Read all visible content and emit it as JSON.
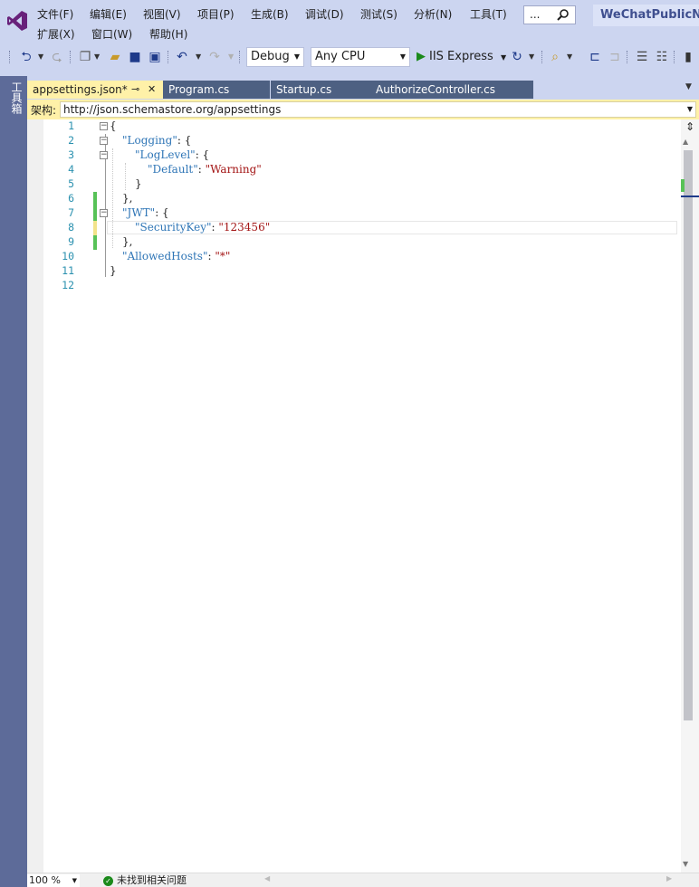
{
  "menu": {
    "row1": [
      "文件(F)",
      "编辑(E)",
      "视图(V)",
      "项目(P)",
      "生成(B)",
      "调试(D)",
      "测试(S)",
      "分析(N)",
      "工具(T)"
    ],
    "row2": [
      "扩展(X)",
      "窗口(W)",
      "帮助(H)"
    ]
  },
  "search": {
    "placeholder": "..."
  },
  "project_name": "WeChatPublicNumber",
  "toolbar": {
    "config": "Debug",
    "platform": "Any CPU",
    "run_label": "IIS Express"
  },
  "toolbox": {
    "label": "工具箱"
  },
  "tabs": [
    {
      "label": "appsettings.json*",
      "active": true,
      "pin": "⊸",
      "close": "✕"
    },
    {
      "label": "Program.cs",
      "active": false
    },
    {
      "label": "Startup.cs",
      "active": false
    },
    {
      "label": "AuthorizeController.cs",
      "active": false
    }
  ],
  "schema": {
    "label": "架构:",
    "url": "http://json.schemastore.org/appsettings"
  },
  "code": {
    "line_numbers": [
      "1",
      "2",
      "3",
      "4",
      "5",
      "6",
      "7",
      "8",
      "9",
      "10",
      "11",
      "12"
    ],
    "l1": "{",
    "l2_key": "\"Logging\"",
    "l2_rest": ": {",
    "l3_key": "\"LogLevel\"",
    "l3_rest": ": {",
    "l4_key": "\"Default\"",
    "l4_colon": ": ",
    "l4_val": "\"Warning\"",
    "l5": "}",
    "l6": "},",
    "l7_key": "\"JWT\"",
    "l7_rest": ": {",
    "l8_key": "\"SecurityKey\"",
    "l8_colon": ": ",
    "l8_val": "\"123456\"",
    "l9": "},",
    "l10_key": "\"AllowedHosts\"",
    "l10_colon": ": ",
    "l10_val": "\"*\"",
    "l11": "}"
  },
  "status": {
    "zoom": "100 %",
    "issues": "未找到相关问题"
  },
  "colors": {
    "key": "#2e75b6",
    "string": "#a31515",
    "change_saved": "#57c257",
    "change_unsaved": "#f2e38a",
    "accent": "#68217a"
  }
}
